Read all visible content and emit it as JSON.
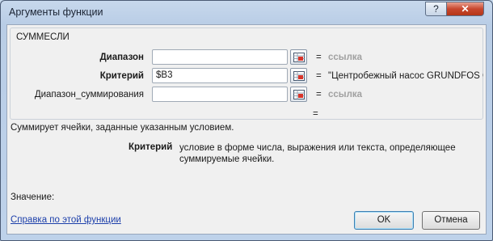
{
  "window": {
    "title": "Аргументы функции",
    "help_label": "?",
    "close_label": "✕"
  },
  "function_name": "СУММЕСЛИ",
  "arguments": [
    {
      "label": "Диапазон",
      "value": "",
      "result": "ссылка",
      "bold": true
    },
    {
      "label": "Критерий",
      "value": "$B3",
      "result": "\"Центробежный насос  GRUNDFOS CF",
      "bold": true
    },
    {
      "label": "Диапазон_суммирования",
      "value": "",
      "result": "ссылка",
      "bold": false
    }
  ],
  "equals_sign": "=",
  "description": "Суммирует ячейки, заданные указанным условием.",
  "argument_help": {
    "name": "Критерий",
    "text": "условие в форме числа, выражения или текста, определяющее суммируемые ячейки."
  },
  "value_label": "Значение:",
  "help_link": "Справка по этой функции",
  "buttons": {
    "ok": "OK",
    "cancel": "Отмена"
  },
  "icons": {
    "collapse": "range-select-icon"
  }
}
